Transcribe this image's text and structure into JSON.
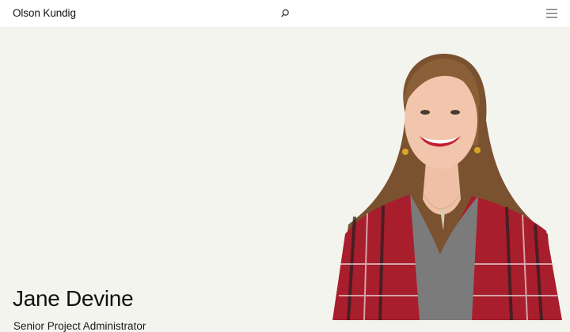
{
  "header": {
    "logo": "Olson Kundig",
    "search_icon": "search-icon",
    "menu_icon": "hamburger-menu-icon"
  },
  "profile": {
    "name": "Jane Devine",
    "title": "Senior Project Administrator"
  },
  "colors": {
    "background": "#f4f4ef",
    "header_background": "#ffffff",
    "text": "#111111"
  }
}
